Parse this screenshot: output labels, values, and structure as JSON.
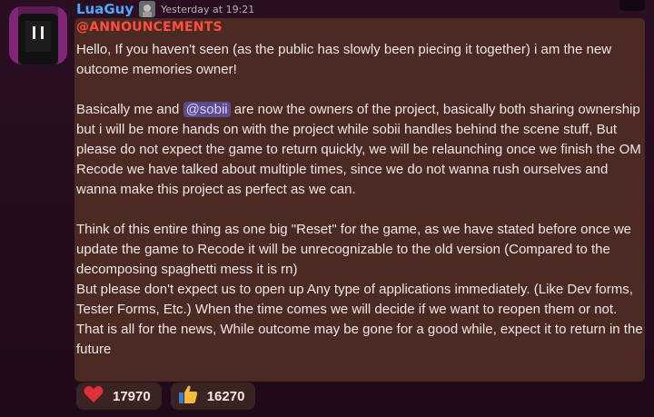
{
  "message": {
    "author": "LuaGuy",
    "timestamp": "Yesterday at 19:21",
    "channel": "@ANNOUNCEMENTS",
    "paragraphs": [
      "Hello, If you haven't seen (as the public has slowly been piecing it together) i am the new outcome memories owner!",
      "",
      "Basically me and ",
      "@sobii",
      "  are now the owners of the project, basically both sharing ownership but i will be more hands on with the project while sobii handles behind the scene stuff, But please do not expect the game to return quickly, we will be relaunching once we finish the OM Recode we have talked about multiple times, since we do not wanna rush ourselves and wanna make this project as perfect as we can.",
      "",
      "Think of this entire thing as one big \"Reset\" for the game, as we have stated before once we update the game to Recode it will be unrecognizable to the old version (Compared to the decomposing spaghetti mess it is rn)",
      "But please don't expect us to open up Any type of applications immediately. (Like Dev forms, Tester Forms, Etc.) When the time comes we will decide if we want to reopen them or not.",
      "That is all for the news, While outcome may be gone for a good while, expect it to return in the future"
    ],
    "reactions": [
      {
        "icon": "heart-icon",
        "count": "17970",
        "color": "#e0303a"
      },
      {
        "icon": "thumbs-up-icon",
        "count": "16270",
        "color": "#f5b93b"
      }
    ]
  },
  "colors": {
    "username": "#4fa8ff",
    "channel": "#ff4d3f",
    "bubble": "#4a2a23",
    "mention_bg": "#5f4b8b"
  }
}
